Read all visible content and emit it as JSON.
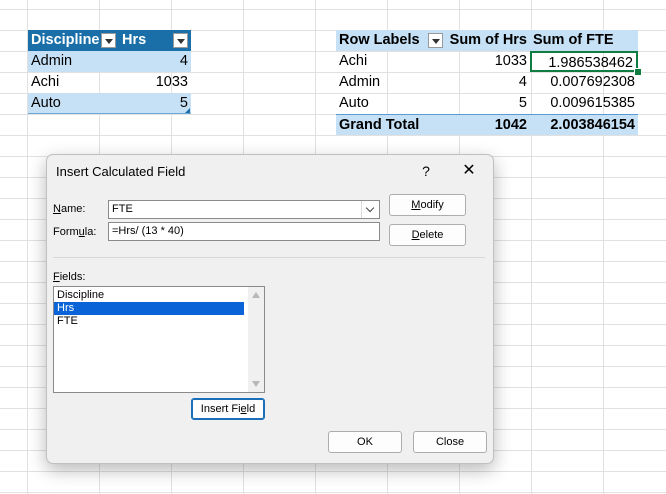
{
  "table": {
    "headers": [
      "Discipline",
      "Hrs"
    ],
    "rows": [
      {
        "discipline": "Admin",
        "hrs": "4"
      },
      {
        "discipline": "Achi",
        "hrs": "1033"
      },
      {
        "discipline": "Auto",
        "hrs": "5"
      }
    ]
  },
  "pivot": {
    "headers": [
      "Row Labels",
      "Sum of Hrs",
      "Sum of FTE"
    ],
    "rows": [
      {
        "label": "Achi",
        "hrs": "1033",
        "fte": "1.986538462"
      },
      {
        "label": "Admin",
        "hrs": "4",
        "fte": "0.007692308"
      },
      {
        "label": "Auto",
        "hrs": "5",
        "fte": "0.009615385"
      }
    ],
    "total": {
      "label": "Grand Total",
      "hrs": "1042",
      "fte": "2.003846154"
    }
  },
  "dialog": {
    "title": "Insert Calculated Field",
    "help": "?",
    "close": "✕",
    "name_label_pre": "N",
    "name_label_post": "ame:",
    "name_value": "FTE",
    "formula_label_pre": "Form",
    "formula_label_u": "u",
    "formula_label_post": "la:",
    "formula_value": "=Hrs/ (13 * 40)",
    "modify_pre": "",
    "modify_u": "M",
    "modify_post": "odify",
    "delete_pre": "",
    "delete_u": "D",
    "delete_post": "elete",
    "fields_label_u": "F",
    "fields_label_post": "ields:",
    "fields": [
      "Discipline",
      "Hrs",
      "FTE"
    ],
    "selected_field": "Hrs",
    "insert_pre": "Insert Fi",
    "insert_u": "e",
    "insert_post": "ld",
    "ok": "OK",
    "cancel": "Close"
  }
}
